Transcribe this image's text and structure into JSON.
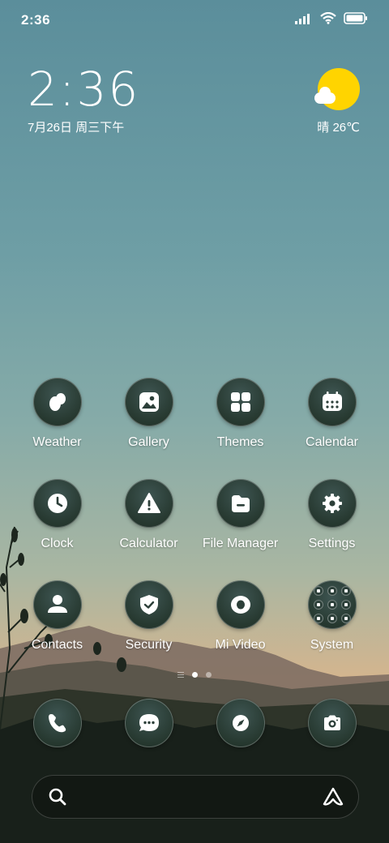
{
  "status_bar": {
    "time": "2:36",
    "icons": [
      "signal-icon",
      "wifi-icon",
      "battery-icon"
    ]
  },
  "clock_widget": {
    "time": "2:36",
    "date": "7月26日 周三下午"
  },
  "weather_widget": {
    "condition_temp": "晴 26℃",
    "icon": "sunny-cloud-icon"
  },
  "apps": [
    {
      "label": "Weather",
      "icon": "weather-icon"
    },
    {
      "label": "Gallery",
      "icon": "gallery-icon"
    },
    {
      "label": "Themes",
      "icon": "themes-icon"
    },
    {
      "label": "Calendar",
      "icon": "calendar-icon"
    },
    {
      "label": "Clock",
      "icon": "clock-icon"
    },
    {
      "label": "Calculator",
      "icon": "calculator-icon"
    },
    {
      "label": "File Manager",
      "icon": "file-manager-icon"
    },
    {
      "label": "Settings",
      "icon": "settings-icon"
    },
    {
      "label": "Contacts",
      "icon": "contacts-icon"
    },
    {
      "label": "Security",
      "icon": "security-icon"
    },
    {
      "label": "Mi Video",
      "icon": "mi-video-icon"
    },
    {
      "label": "System",
      "icon": "folder-icon"
    }
  ],
  "page_indicator": {
    "pages": 2,
    "current": 1
  },
  "dock": [
    {
      "icon": "phone-icon"
    },
    {
      "icon": "messages-icon"
    },
    {
      "icon": "browser-icon"
    },
    {
      "icon": "camera-icon"
    }
  ],
  "search_bar": {
    "icons": [
      "search-icon",
      "assistant-icon"
    ]
  },
  "colors": {
    "icon_bg": "#26382f",
    "sun": "#ffd400",
    "text": "#ffffff"
  }
}
